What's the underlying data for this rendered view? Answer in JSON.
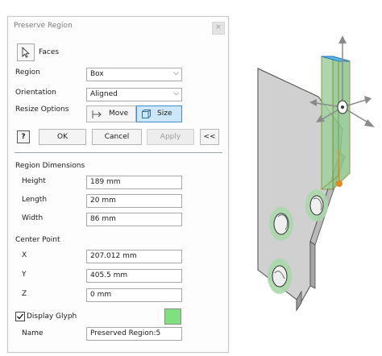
{
  "dialog": {
    "title": "Preserve Region",
    "close_glyph": "×",
    "faces_label": "Faces",
    "region": {
      "label": "Region",
      "value": "Box"
    },
    "orientation": {
      "label": "Orientation",
      "value": "Aligned"
    },
    "resize": {
      "label": "Resize Options",
      "move_label": "Move",
      "size_label": "Size",
      "active": "Size"
    },
    "actions": {
      "help": "?",
      "ok": "OK",
      "cancel": "Cancel",
      "apply": "Apply",
      "collapse": "<<"
    },
    "dimensions": {
      "header": "Region Dimensions",
      "height": {
        "label": "Height",
        "value": "189 mm"
      },
      "length": {
        "label": "Length",
        "value": "20 mm"
      },
      "width": {
        "label": "Width",
        "value": "86 mm"
      }
    },
    "center": {
      "header": "Center Point",
      "x": {
        "label": "X",
        "value": "207.012 mm"
      },
      "y": {
        "label": "Y",
        "value": "405.5 mm"
      },
      "z": {
        "label": "Z",
        "value": "0 mm"
      }
    },
    "glyph": {
      "label": "Display Glyph",
      "checked": true,
      "color": "#7ee07e"
    },
    "name": {
      "label": "Name",
      "value": "Preserved Region:5"
    }
  },
  "colors": {
    "accent": "#3a8fd6",
    "part_gray": "#cfcfcf",
    "region_green": "#9fd09f",
    "face_blue": "#58b7e6",
    "handle_orange": "#e58a1a"
  }
}
